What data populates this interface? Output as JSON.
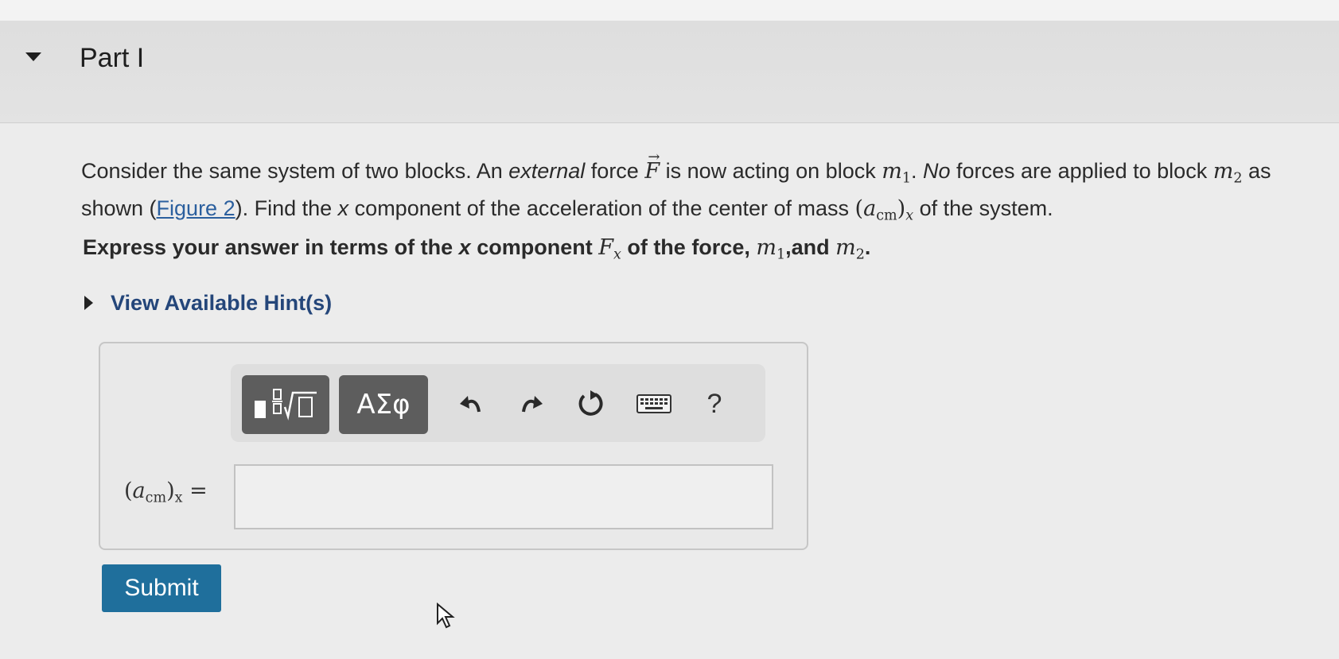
{
  "part": {
    "title": "Part I"
  },
  "question": {
    "t1": "Consider the same system of two blocks. An ",
    "external": "external",
    "t2": " force ",
    "F": "F",
    "t3": " is now acting on block ",
    "m1_base": "m",
    "m1_sub": "1",
    "t4": ". ",
    "no_forces": "No",
    "t5": " forces are applied to block ",
    "m2_base": "m",
    "m2_sub": "2",
    "t6": " as shown (",
    "figure_link": "Figure 2",
    "t7": "). Find the ",
    "x": "x",
    "t8": " component of the acceleration of the center of mass ",
    "acm_open": "(",
    "acm_a": "a",
    "acm_sub": "cm",
    "acm_close": ")",
    "acm_x": "x",
    "t9": " of the system."
  },
  "express": {
    "t1": "Express your answer in terms of the ",
    "x": "x",
    "t2": " component ",
    "F": "F",
    "Fx": "x",
    "t3": " of the force, ",
    "m1_base": "m",
    "m1_sub": "1",
    "t4": ",and ",
    "m2_base": "m",
    "m2_sub": "2",
    "t5": "."
  },
  "hints": {
    "label": "View Available Hint(s)"
  },
  "toolbar": {
    "greek_label": "ΑΣφ",
    "help_label": "?"
  },
  "answer": {
    "open": "(",
    "a": "a",
    "sub": "cm",
    "close": ")",
    "x": "x",
    "eq": " =",
    "value": ""
  },
  "submit": {
    "label": "Submit"
  },
  "colors": {
    "submit": "#1f6f9c",
    "link": "#2b5f9e",
    "toolbar_button": "#5d5d5d"
  }
}
